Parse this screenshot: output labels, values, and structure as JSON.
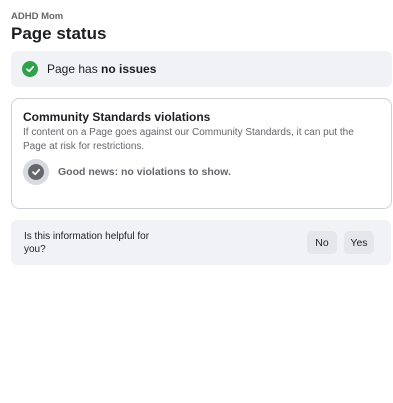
{
  "header": {
    "page_name": "ADHD Mom",
    "title": "Page status"
  },
  "status_banner": {
    "text_prefix": "Page has ",
    "text_emphasis": "no issues",
    "icon": "check-circle-icon",
    "icon_color": "#31a24c"
  },
  "violations_card": {
    "title": "Community Standards violations",
    "description": "If content on a Page goes against our Community Standards, it can put the Page at risk for restrictions.",
    "status_text": "Good news: no violations to show.",
    "icon": "check-circle-icon"
  },
  "feedback": {
    "question": "Is this information helpful for you?",
    "no_label": "No",
    "yes_label": "Yes"
  }
}
